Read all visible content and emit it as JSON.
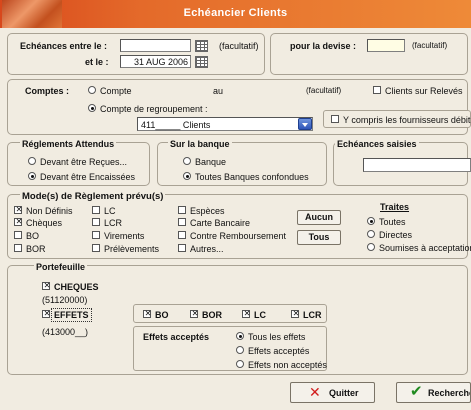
{
  "window": {
    "title": "Echéancier Clients"
  },
  "echeances": {
    "entre_label": "Echéances entre le :",
    "et_label": "et le :",
    "date_from": "",
    "date_to": "31 AUG 2006",
    "facultatif1": "(facultatif)",
    "facultatif2": "(facultatif)"
  },
  "devise": {
    "label": "pour la devise :",
    "value": "",
    "facultatif": "(facultatif)"
  },
  "comptes": {
    "label": "Comptes :",
    "compte_label": "Compte",
    "au_label": "au",
    "facultatif": "(facultatif)",
    "regroupement_label": "Compte de regroupement :",
    "regroupement_value": "411_____ Clients",
    "clients_releves": "Clients sur Relevés",
    "fournisseurs": "Y compris les fournisseurs débit"
  },
  "reglements": {
    "title": "Réglements Attendus",
    "option1": "Devant être Reçues...",
    "option2": "Devant être Encaissées"
  },
  "banque": {
    "title": "Sur la banque",
    "option1": "Banque",
    "option2": "Toutes Banques confondues"
  },
  "saisies": {
    "title": "Echéances saisies",
    "value": ""
  },
  "modes": {
    "title": "Mode(s) de Règlement prévu(s)",
    "col1": [
      "Non Définis",
      "Chèques",
      "BO",
      "BOR"
    ],
    "col2": [
      "LC",
      "LCR",
      "Virements",
      "Prélèvements"
    ],
    "col3": [
      "Espèces",
      "Carte Bancaire",
      "Contre Remboursement",
      "Autres..."
    ],
    "aucun": "Aucun",
    "tous": "Tous"
  },
  "traites": {
    "title": "Traites",
    "option1": "Toutes",
    "option2": "Directes",
    "option3": "Soumises à acceptation"
  },
  "portefeuille": {
    "title": "Portefeuille",
    "cheques_label": "CHEQUES",
    "cheques_account": "(51120000)",
    "effets_label": "EFFETS",
    "effets_account": "(413000__)",
    "bo": "BO",
    "bor": "BOR",
    "lc": "LC",
    "lcr": "LCR",
    "acceptes_title": "Effets acceptés",
    "acc1": "Tous les effets",
    "acc2": "Effets acceptés",
    "acc3": "Effets non acceptés"
  },
  "buttons": {
    "quitter": "Quitter",
    "rechercher": "Rechercher"
  },
  "colors": {
    "titlebar": "#e46a2a",
    "window_bg": "#f1ece1",
    "accent": "#2e55b8"
  }
}
